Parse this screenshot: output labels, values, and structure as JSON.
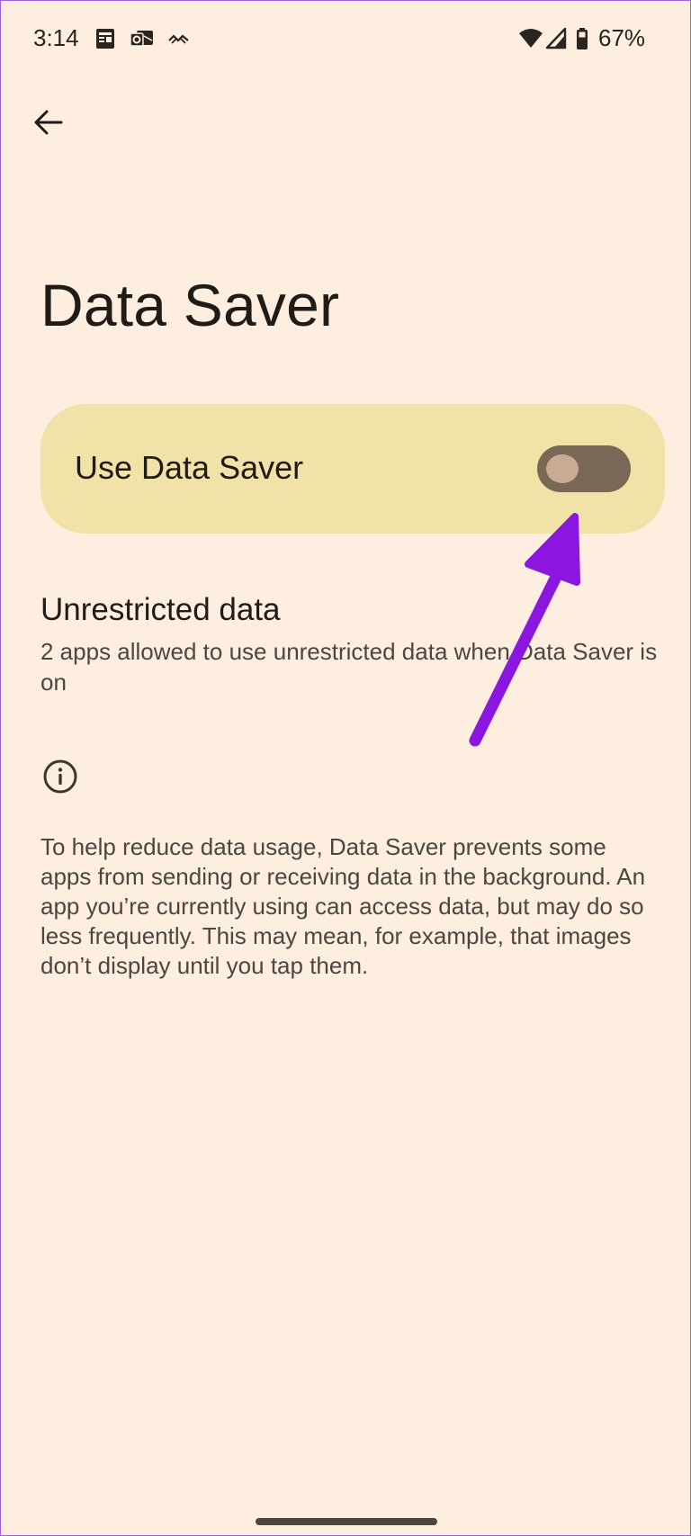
{
  "status_bar": {
    "time": "3:14",
    "battery": "67%",
    "icons": [
      "news-icon",
      "outlook-icon",
      "vpn-squiggle-icon",
      "wifi-icon",
      "signal-icon",
      "battery-icon"
    ]
  },
  "toolbar": {
    "back_icon": "arrow-back-icon"
  },
  "page": {
    "title": "Data Saver"
  },
  "main_switch": {
    "label": "Use Data Saver",
    "state": "off"
  },
  "unrestricted": {
    "title": "Unrestricted data",
    "subtitle": "2 apps allowed to use unrestricted data when Data Saver is on"
  },
  "footer": {
    "icon": "info-icon",
    "text": "To help reduce data usage, Data Saver prevents some apps from sending or receiving data in the background. An app you’re currently using can access data, but may do so less frequently. This may mean, for example, that images don’t display until you tap them."
  },
  "annotation": {
    "arrow_color": "#8a16e0"
  },
  "colors": {
    "background": "#fdeee0",
    "card": "#f1e2a8",
    "switch_track": "#7a6856",
    "switch_thumb": "#c8aa95",
    "text_primary": "#1f1b16",
    "text_secondary": "#4d4640"
  }
}
